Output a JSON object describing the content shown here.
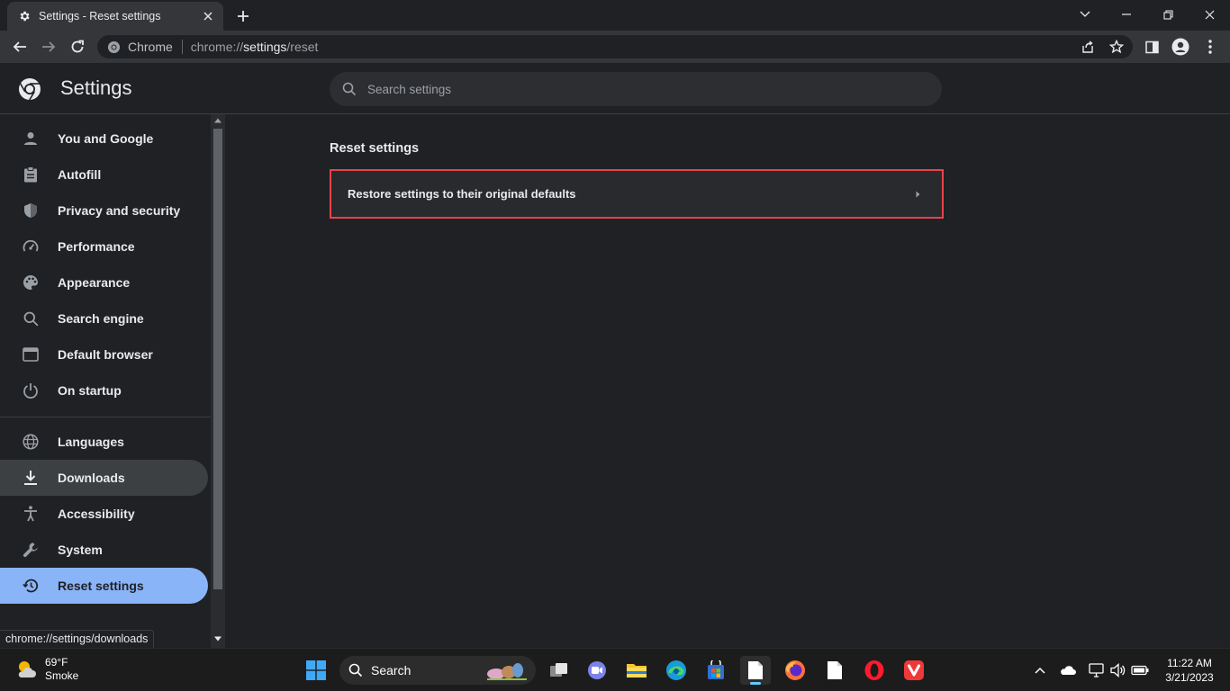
{
  "browser": {
    "tab_title": "Settings - Reset settings",
    "omnibox_chip": "Chrome",
    "url_scheme": "chrome://",
    "url_host": "settings",
    "url_path": "/reset"
  },
  "settings": {
    "title": "Settings",
    "search_placeholder": "Search settings"
  },
  "sidebar": {
    "items": [
      {
        "label": "You and Google",
        "icon": "person-icon"
      },
      {
        "label": "Autofill",
        "icon": "clipboard-icon"
      },
      {
        "label": "Privacy and security",
        "icon": "shield-icon"
      },
      {
        "label": "Performance",
        "icon": "speedometer-icon"
      },
      {
        "label": "Appearance",
        "icon": "palette-icon"
      },
      {
        "label": "Search engine",
        "icon": "search-icon"
      },
      {
        "label": "Default browser",
        "icon": "browser-window-icon"
      },
      {
        "label": "On startup",
        "icon": "power-icon"
      },
      {
        "label": "Languages",
        "icon": "globe-icon"
      },
      {
        "label": "Downloads",
        "icon": "download-icon"
      },
      {
        "label": "Accessibility",
        "icon": "accessibility-icon"
      },
      {
        "label": "System",
        "icon": "wrench-icon"
      },
      {
        "label": "Reset settings",
        "icon": "history-icon"
      }
    ],
    "hovered": "Downloads",
    "selected": "Reset settings"
  },
  "status_bubble": "chrome://settings/downloads",
  "main": {
    "section_title": "Reset settings",
    "restore_label": "Restore settings to their original defaults"
  },
  "taskbar": {
    "weather_temp": "69°F",
    "weather_desc": "Smoke",
    "search_label": "Search",
    "time": "11:22 AM",
    "date": "3/21/2023"
  },
  "colors": {
    "accent": "#8ab4f8",
    "highlight_border": "#e8434c",
    "background": "#202124"
  }
}
